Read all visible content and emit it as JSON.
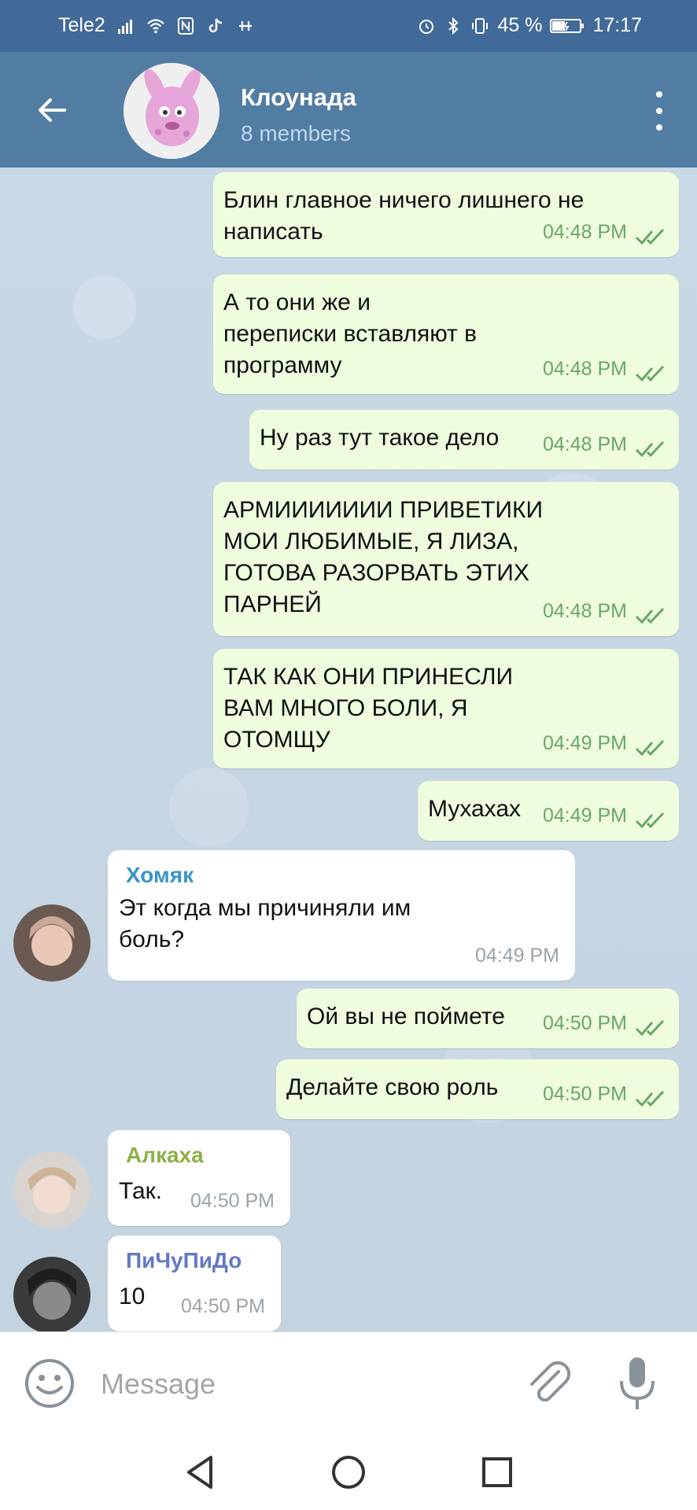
{
  "status_bar": {
    "carrier": "Tele2",
    "battery_percent": "45 %",
    "time": "17:17",
    "icons": [
      "signal-icon",
      "wifi-icon",
      "nfc-icon",
      "tiktok-icon",
      "usb-icon",
      "alarm-icon",
      "bluetooth-icon",
      "vibrate-icon",
      "battery-icon"
    ]
  },
  "header": {
    "title": "Клоунада",
    "subtitle": "8 members",
    "back_icon": "arrow-left-icon",
    "menu_icon": "more-vertical-icon"
  },
  "messages": [
    {
      "dir": "out",
      "text": "Блин главное ничего лишнего не\nнаписать",
      "time": "04:48 PM",
      "status": "read"
    },
    {
      "dir": "out",
      "text": "А то они же и\nпереписки вставляют в\nпрограмму",
      "time": "04:48 PM",
      "status": "read"
    },
    {
      "dir": "out",
      "text": "Ну раз тут такое дело",
      "time": "04:48 PM",
      "status": "read"
    },
    {
      "dir": "out",
      "text": "АРМИИИИИИИ ПРИВЕТИКИ\nМОИ ЛЮБИМЫЕ, Я ЛИЗА,\nГОТОВА РАЗОРВАТЬ ЭТИХ\nПАРНЕЙ",
      "time": "04:48 PM",
      "status": "read"
    },
    {
      "dir": "out",
      "text": "ТАК КАК ОНИ ПРИНЕСЛИ\nВАМ МНОГО БОЛИ, Я\nОТОМЩУ",
      "time": "04:49 PM",
      "status": "read"
    },
    {
      "dir": "out",
      "text": "Мухахах",
      "time": "04:49 PM",
      "status": "read"
    },
    {
      "dir": "in",
      "sender": "Хомяк",
      "sender_color": "#3a94c9",
      "text": "Эт когда мы причиняли им\nболь?",
      "time": "04:49 PM"
    },
    {
      "dir": "out",
      "text": "Ой вы не поймете",
      "time": "04:50 PM",
      "status": "read"
    },
    {
      "dir": "out",
      "text": "Делайте свою роль",
      "time": "04:50 PM",
      "status": "read"
    },
    {
      "dir": "in",
      "sender": "Алкаха",
      "sender_color": "#8db047",
      "text": "Так.",
      "time": "04:50 PM"
    },
    {
      "dir": "in",
      "sender": "ПиЧуПиДо",
      "sender_color": "#6379c2",
      "text": "10",
      "time": "04:50 PM"
    }
  ],
  "input": {
    "placeholder": "Message",
    "emoji_icon": "emoji-icon",
    "attach_icon": "paperclip-icon",
    "mic_icon": "microphone-icon"
  },
  "nav": {
    "back_icon": "nav-back-icon",
    "home_icon": "nav-home-icon",
    "recent_icon": "nav-recent-icon"
  },
  "colors": {
    "header_bg": "#517da2",
    "status_bg": "#426a98",
    "outgoing_bubble": "#effdde",
    "incoming_bubble": "#ffffff",
    "chat_bg": "#c8d7e3",
    "check_color": "#69a66a"
  }
}
